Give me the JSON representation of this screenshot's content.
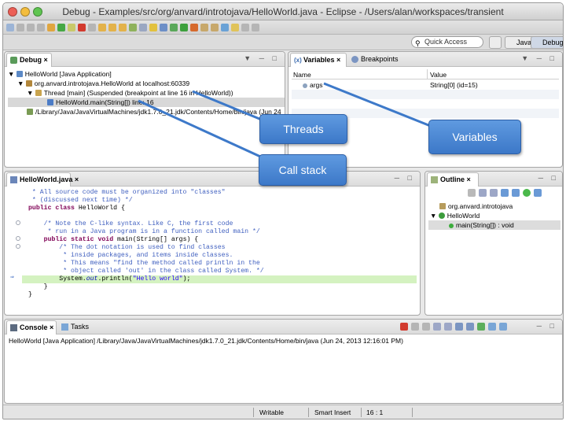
{
  "window": {
    "title": "Debug - Examples/src/org/anvard/introtojava/HelloWorld.java - Eclipse - /Users/alan/workspaces/transient"
  },
  "quick_access": {
    "placeholder": "Quick Access"
  },
  "perspectives": {
    "java": "Java",
    "debug": "Debug"
  },
  "debug_view": {
    "tab": "Debug",
    "rows": [
      "HelloWorld [Java Application]",
      "org.anvard.introtojava.HelloWorld at localhost:60339",
      "Thread [main] (Suspended (breakpoint at line 16 in HelloWorld))",
      "HelloWorld.main(String[]) line: 16",
      "/Library/Java/JavaVirtualMachines/jdk1.7.0_21.jdk/Contents/Home/bin/java (Jun 24"
    ]
  },
  "variables_view": {
    "tab_variables": "Variables",
    "tab_breakpoints": "Breakpoints",
    "col_name": "Name",
    "col_value": "Value",
    "rows": [
      {
        "name": "args",
        "value": "String[0]  (id=15)"
      }
    ]
  },
  "editor": {
    "tab": "HelloWorld.java",
    "lines": [
      " * All source code must be organized into \"classes\"",
      " * (discussed next time) */",
      "public class HelloWorld {",
      "",
      "    /* Note the C-like syntax. Like C, the first code",
      "     * run in a Java program is in a function called main */",
      "    public static void main(String[] args) {",
      "        /* The dot notation is used to find classes",
      "         * inside packages, and items inside classes.",
      "         * This means \"find the method called println in the",
      "         * object called 'out' in the class called System. */",
      "        System.out.println(\"Hello world\");",
      "    }",
      "}"
    ]
  },
  "outline_view": {
    "tab": "Outline",
    "items": [
      "org.anvard.introtojava",
      "HelloWorld",
      "main(String[]) : void"
    ]
  },
  "console_view": {
    "tab_console": "Console",
    "tab_tasks": "Tasks",
    "text": "HelloWorld [Java Application] /Library/Java/JavaVirtualMachines/jdk1.7.0_21.jdk/Contents/Home/bin/java (Jun 24, 2013 12:16:01 PM)"
  },
  "status_bar": {
    "writable": "Writable",
    "insert_mode": "Smart Insert",
    "position": "16 : 1"
  },
  "callouts": {
    "threads": "Threads",
    "variables": "Variables",
    "call_stack": "Call stack"
  },
  "colors": {
    "callout": "#4a86d2",
    "current_line": "#d4f2c0",
    "selection": "#dcdcdc"
  }
}
